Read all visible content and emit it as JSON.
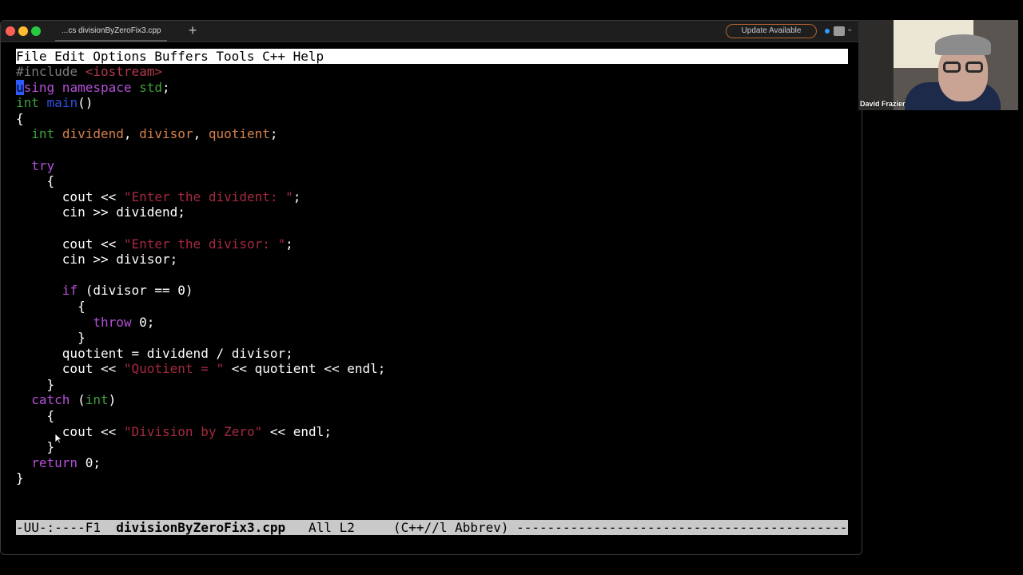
{
  "window": {
    "tab_title": "...cs divisionByZeroFix3.cpp",
    "new_tab_symbol": "+",
    "update_label": "Update Available",
    "status_dot_color": "#2f9bff"
  },
  "menu": [
    "File",
    "Edit",
    "Options",
    "Buffers",
    "Tools",
    "C++",
    "Help"
  ],
  "code": {
    "l1_pre": "#include ",
    "l1_inc": "<iostream>",
    "l2_cursor": "u",
    "l2_kw": "sing namespace",
    "l2_std": " std",
    "l2_end": ";",
    "l3_type": "int",
    "l3_fn": "main",
    "l3_end": "()",
    "l4": "{",
    "l5_type": "int",
    "l5_v1": "dividend",
    "l5_v2": "divisor",
    "l5_v3": "quotient",
    "l7_kw": "try",
    "l8": "{",
    "l9_a": "cout << ",
    "l9_str": "\"Enter the divident: \"",
    "l9_b": ";",
    "l10": "cin >> dividend;",
    "l12_a": "cout << ",
    "l12_str": "\"Enter the divisor: \"",
    "l12_b": ";",
    "l13": "cin >> divisor;",
    "l15_kw": "if",
    "l15_rest": " (divisor == 0)",
    "l16": "{",
    "l17_kw": "throw",
    "l17_rest": " 0;",
    "l18": "}",
    "l19": "quotient = dividend / divisor;",
    "l20_a": "cout << ",
    "l20_str": "\"Quotient = \"",
    "l20_b": " << quotient << endl;",
    "l21": "}",
    "l22_kw": "catch",
    "l22_a": " (",
    "l22_type": "int",
    "l22_b": ")",
    "l23": "{",
    "l24_a": "cout << ",
    "l24_str": "\"Division by Zero\"",
    "l24_b": " << endl;",
    "l25": "}",
    "l26_kw": "return",
    "l26_rest": " 0;",
    "l27": "}"
  },
  "mode_line": {
    "prefix": "-UU-:----F1  ",
    "buffer": "divisionByZeroFix3.cpp",
    "position": "   All L2     ",
    "modes": "(C++//l Abbrev) ------------------------------------------------------------"
  },
  "video": {
    "participant_name": "David Frazier"
  }
}
